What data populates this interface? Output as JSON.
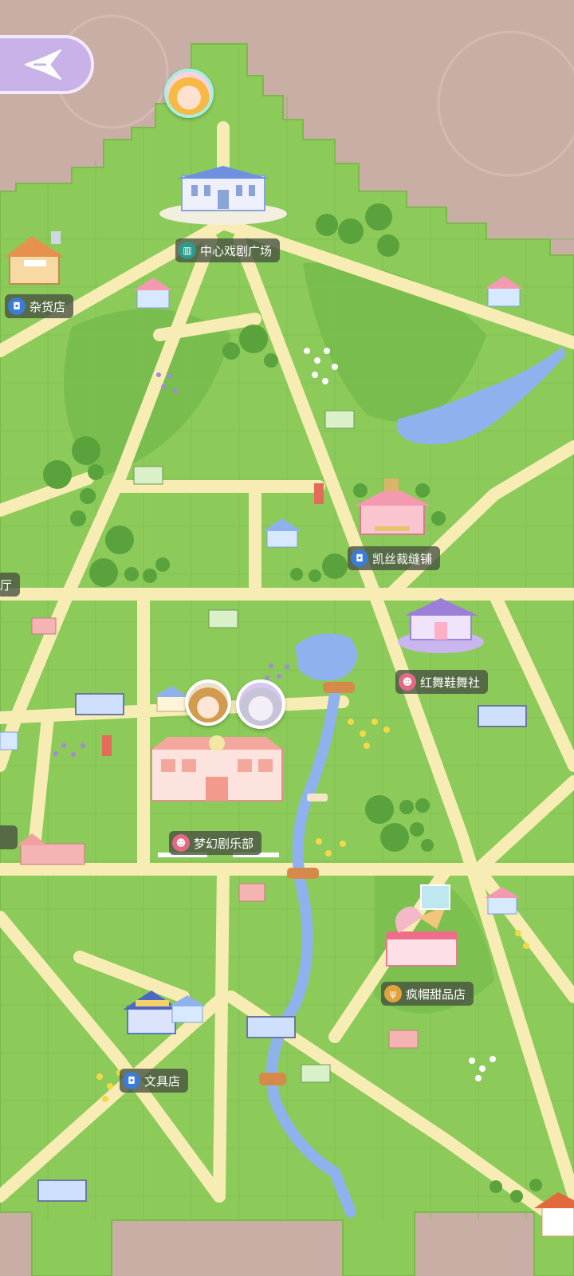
{
  "labels": {
    "central_plaza": "中心戏剧广场",
    "grocery": "杂货店",
    "tailor": "凯丝裁缝铺",
    "partial_left": "厅",
    "shoes": "红舞鞋舞社",
    "club": "梦幻剧乐部",
    "dessert": "疯帽甜品店",
    "stationery": "文具店"
  },
  "icons": {
    "back": "compass-arrow-icon",
    "shop": "shopping-bag-icon",
    "plaza": "theater-building-icon",
    "mask": "drama-mask-icon",
    "food": "fork-spoon-icon"
  },
  "colors": {
    "grass": "#8cca5a",
    "grass_dark": "#6db646",
    "path": "#f6ecb4",
    "river": "#8fb2ee",
    "ground": "#c9aea5"
  }
}
